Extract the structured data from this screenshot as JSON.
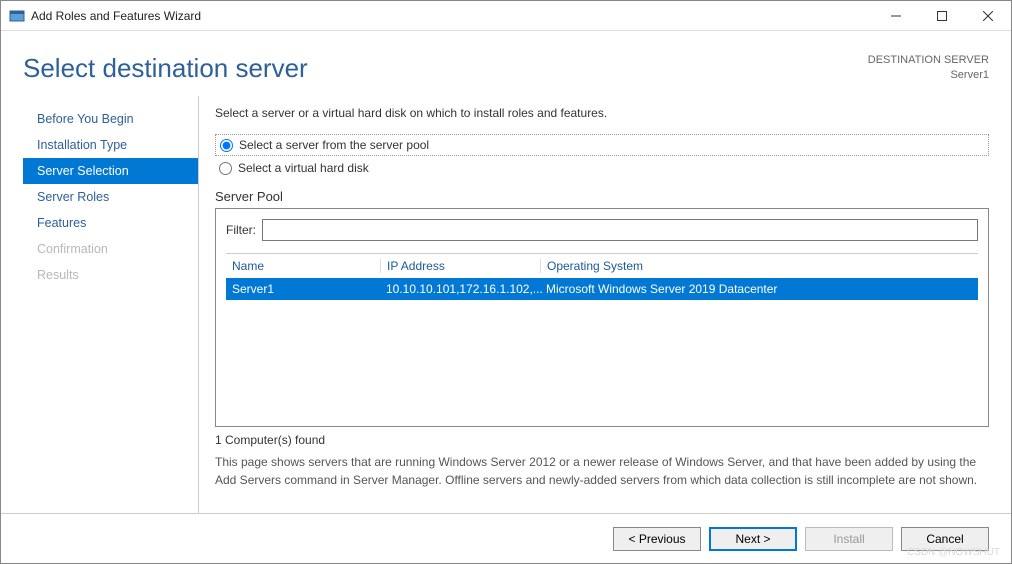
{
  "window": {
    "title": "Add Roles and Features Wizard"
  },
  "header": {
    "page_title": "Select destination server",
    "dest_label": "DESTINATION SERVER",
    "dest_value": "Server1"
  },
  "nav": {
    "items": [
      {
        "label": "Before You Begin",
        "state": "normal"
      },
      {
        "label": "Installation Type",
        "state": "normal"
      },
      {
        "label": "Server Selection",
        "state": "active"
      },
      {
        "label": "Server Roles",
        "state": "normal"
      },
      {
        "label": "Features",
        "state": "normal"
      },
      {
        "label": "Confirmation",
        "state": "disabled"
      },
      {
        "label": "Results",
        "state": "disabled"
      }
    ]
  },
  "content": {
    "instruction": "Select a server or a virtual hard disk on which to install roles and features.",
    "radio_pool": "Select a server from the server pool",
    "radio_vhd": "Select a virtual hard disk",
    "section_label": "Server Pool",
    "filter_label": "Filter:",
    "filter_value": "",
    "columns": {
      "name": "Name",
      "ip": "IP Address",
      "os": "Operating System"
    },
    "rows": [
      {
        "name": "Server1",
        "ip": "10.10.10.101,172.16.1.102,...",
        "os": "Microsoft Windows Server 2019 Datacenter"
      }
    ],
    "found": "1 Computer(s) found",
    "note": "This page shows servers that are running Windows Server 2012 or a newer release of Windows Server, and that have been added by using the Add Servers command in Server Manager. Offline servers and newly-added servers from which data collection is still incomplete are not shown."
  },
  "footer": {
    "previous": "< Previous",
    "next": "Next >",
    "install": "Install",
    "cancel": "Cancel"
  },
  "watermark": "CSDN @NOWSHUT"
}
